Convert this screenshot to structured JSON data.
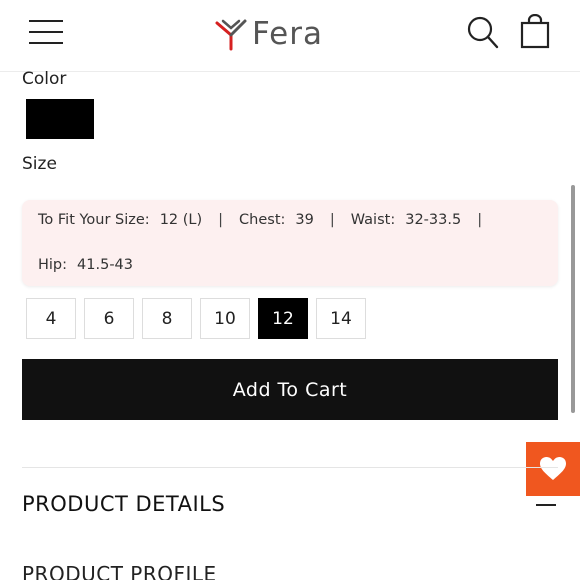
{
  "header": {
    "brand": "Fera",
    "menu_icon": "hamburger-menu-icon",
    "search_icon": "search-icon",
    "cart_icon": "shopping-bag-icon"
  },
  "color": {
    "label": "Color",
    "selected_swatch": "#000000"
  },
  "size": {
    "label": "Size",
    "fit_label": "To Fit Your Size:",
    "fit_value": "12 (L)",
    "chest_label": "Chest:",
    "chest_value": "39",
    "waist_label": "Waist:",
    "waist_value": "32-33.5",
    "hip_label": "Hip:",
    "hip_value": "41.5-43",
    "separator": "|",
    "options": [
      "4",
      "6",
      "8",
      "10",
      "12",
      "14"
    ],
    "selected": "12"
  },
  "add_to_cart_label": "Add To Cart",
  "wishlist_icon": "heart-icon",
  "wishlist_color": "#f0571f",
  "sections": {
    "product_details": "PRODUCT DETAILS",
    "product_profile": "PRODUCT PROFILE"
  }
}
